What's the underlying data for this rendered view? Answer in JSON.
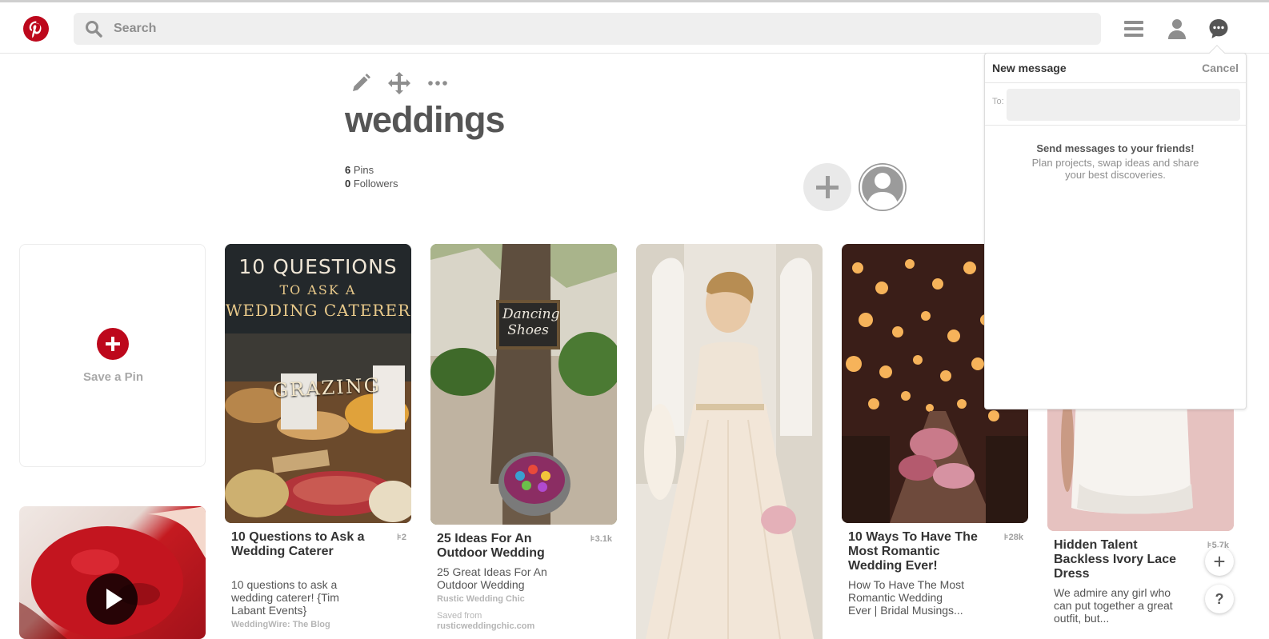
{
  "header": {
    "logo_alt": "Pinterest",
    "search_placeholder": "Search",
    "icons": [
      "menu-icon",
      "profile-icon",
      "messages-icon"
    ]
  },
  "board": {
    "title": "weddings",
    "pins_count": "6",
    "pins_label": " Pins",
    "followers_count": "0",
    "followers_label": " Followers",
    "tool_icons": [
      "edit-icon",
      "move-icon",
      "more-icon"
    ]
  },
  "save_card": {
    "label": "Save a Pin"
  },
  "pins": [
    {
      "title": "10 Questions to Ask a Wedding Caterer",
      "repins": "2",
      "description": "10 questions to ask a wedding caterer! {Tim Labant Events}",
      "source": "WeddingWire: The Blog",
      "image_text": [
        "10 QUESTIONS",
        "TO ASK A",
        "WEDDING CATERER",
        "GRAZING"
      ]
    },
    {
      "title": "25 Ideas For An Outdoor Wedding",
      "repins": "3.1k",
      "description": "25 Great Ideas For An Outdoor Wedding",
      "source": "Rustic Wedding Chic",
      "saved_from_label": "Saved from",
      "saved_from": "rusticweddingchic.com",
      "image_text": [
        "Dancing",
        "Shoes"
      ]
    },
    {
      "title": "",
      "description": ""
    },
    {
      "title": "10 Ways To Have The Most Romantic Wedding Ever!",
      "repins": "28k",
      "description": "How To Have The Most Romantic Wedding Ever | Bridal Musings..."
    },
    {
      "title": "Hidden Talent Backless Ivory Lace Dress",
      "repins": "5.7k",
      "description": "We admire any girl who can put together a great outfit, but..."
    }
  ],
  "message_panel": {
    "title": "New message",
    "cancel": "Cancel",
    "to_label": "To:",
    "to_value": "",
    "empty_heading": "Send messages to your friends!",
    "empty_text": "Plan projects, swap ideas and share your best discoveries."
  },
  "floating": {
    "add": "+",
    "help": "?"
  },
  "colors": {
    "brand": "#bd081c",
    "search_bg": "#efefef",
    "icon_gray": "#8e8e8e"
  }
}
